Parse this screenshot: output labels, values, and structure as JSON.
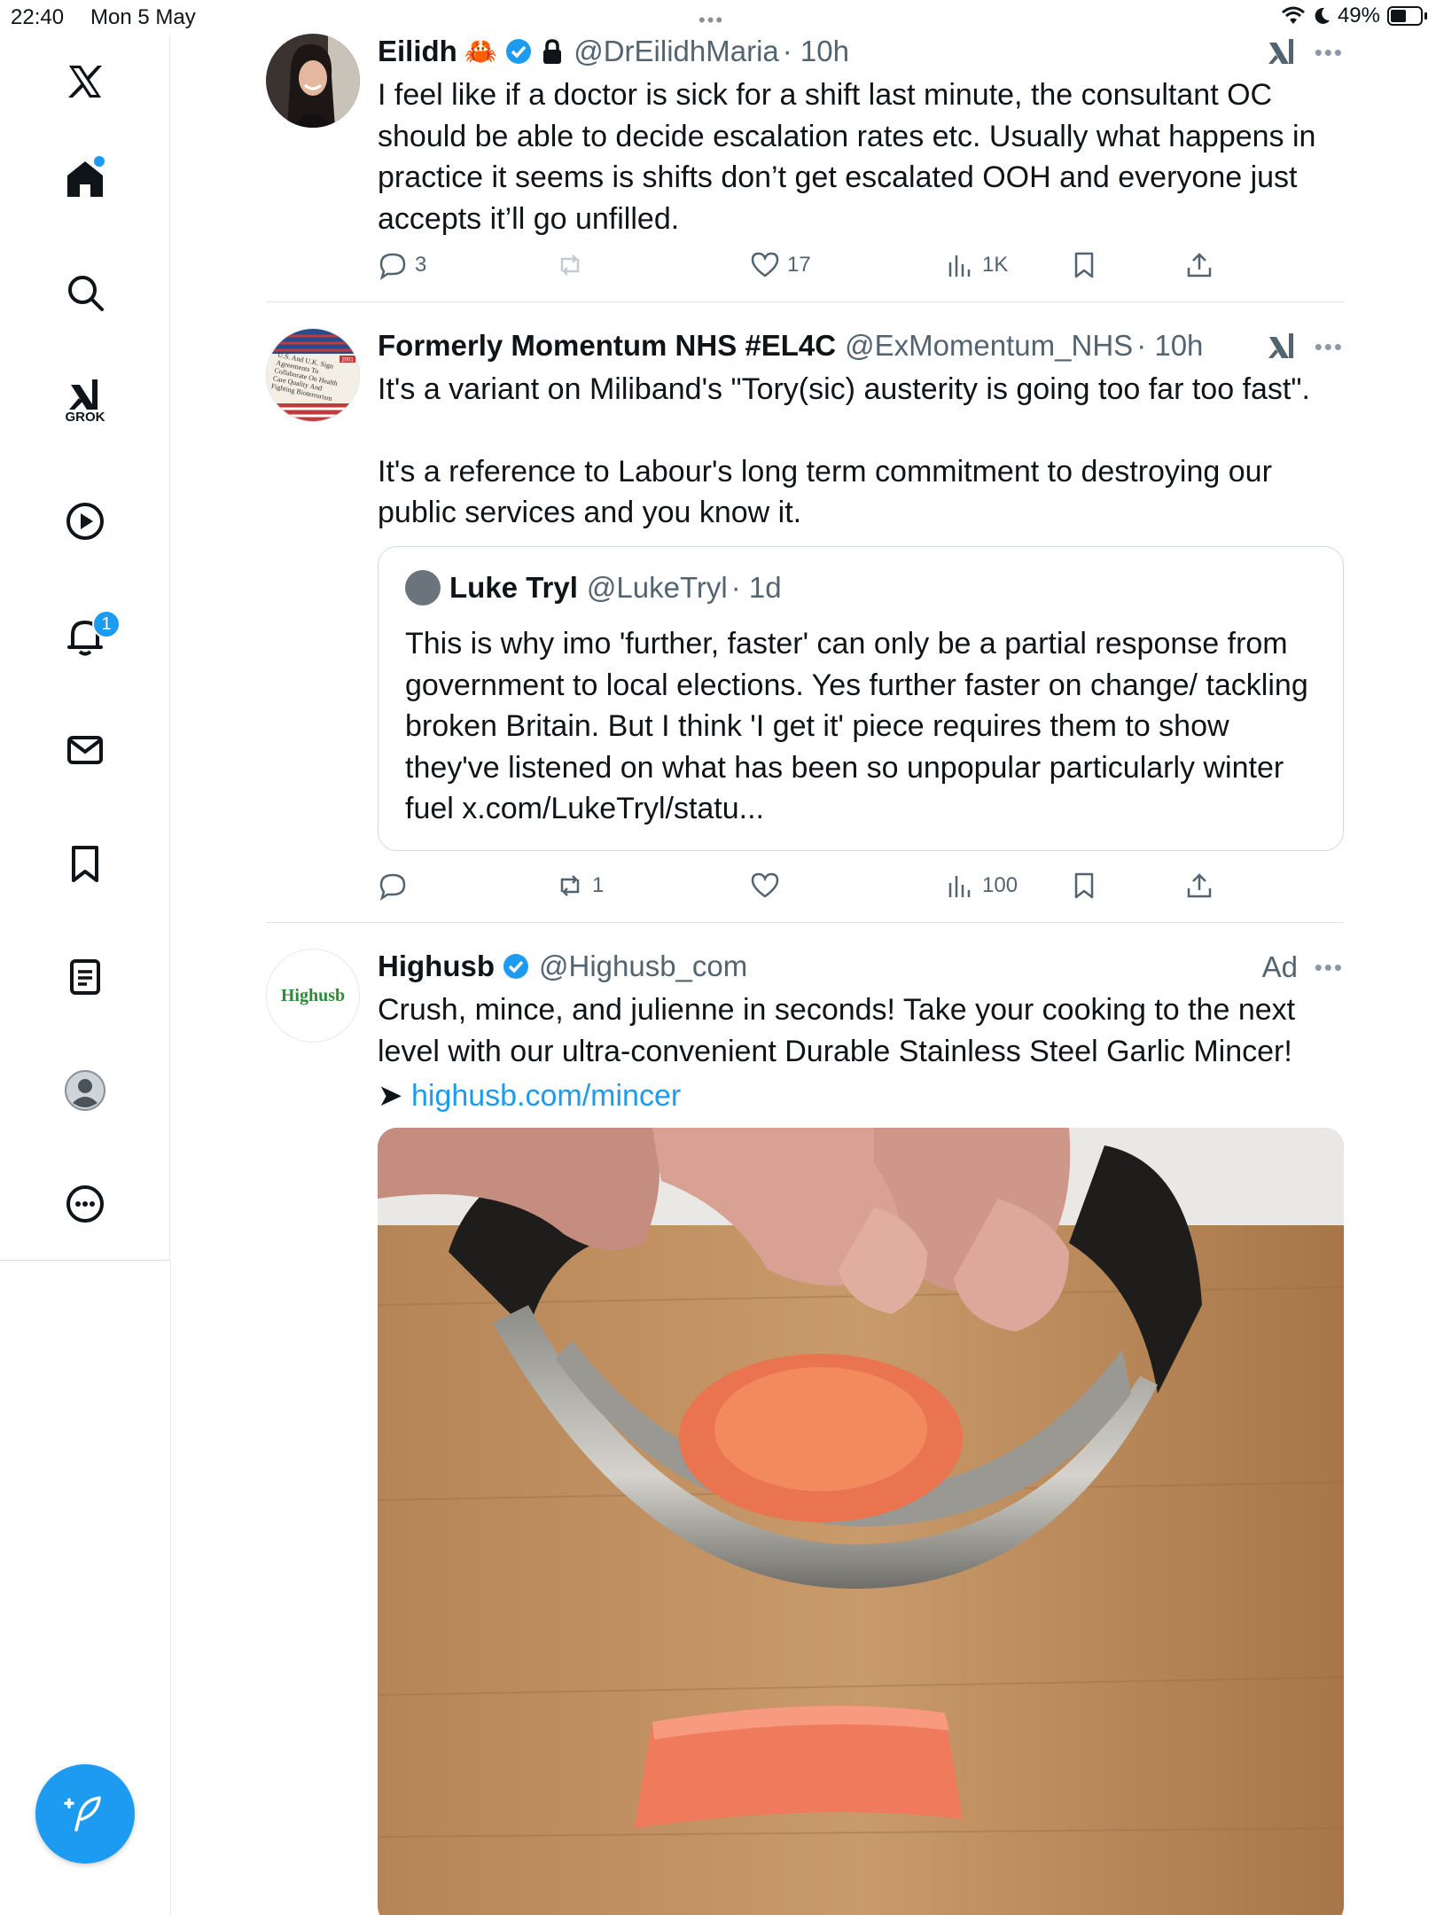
{
  "status_bar": {
    "time": "22:40",
    "date": "Mon 5 May",
    "battery": "49%"
  },
  "sidebar": {
    "items": [
      {
        "name": "x-logo-icon"
      },
      {
        "name": "home-icon"
      },
      {
        "name": "search-icon"
      },
      {
        "name": "grok-icon",
        "label": "GROK"
      },
      {
        "name": "video-icon"
      },
      {
        "name": "notifications-icon",
        "badge": "1"
      },
      {
        "name": "messages-icon"
      },
      {
        "name": "bookmarks-icon"
      },
      {
        "name": "lists-icon"
      },
      {
        "name": "profile-icon"
      },
      {
        "name": "more-icon"
      }
    ]
  },
  "tweets": [
    {
      "name": "Eilidh",
      "handle": "@DrEilidhMaria",
      "time": "· 10h",
      "text": "I feel like if a doctor is sick for a shift last minute, the consultant OC should be able to decide escalation rates etc. Usually what happens in practice it seems is shifts don’t get escalated OOH and everyone just accepts it’ll go unfilled.",
      "replies": "3",
      "retweets": "",
      "likes": "17",
      "views": "1K"
    },
    {
      "name": "Formerly Momentum NHS #EL4C",
      "handle": "@ExMomentum_NHS",
      "time": "· 10h",
      "text_p1": "It's a variant on Miliband's \"Tory(sic) austerity is going too far too fast\".",
      "text_p2": "It's a reference to Labour's long term commitment to destroying our public services and you know it.",
      "avatar_text": "U.S. And U.K. Sign Agreements To Collaborate On Health Care Quality And Fighting Bioterrorism",
      "avatar_badge": "2001",
      "quote": {
        "name": "Luke Tryl",
        "handle": "@LukeTryl",
        "time": "· 1d",
        "text": "This is why imo 'further, faster' can only be a partial response from government to local elections. Yes further faster on change/ tackling broken Britain. But I think 'I get it' piece requires them to show they've listened on what has been so unpopular particularly winter fuel x.com/LukeTryl/statu..."
      },
      "replies": "",
      "retweets": "1",
      "likes": "",
      "views": "100"
    },
    {
      "name": "Highusb",
      "handle": "@Highusb_com",
      "ad_label": "Ad",
      "avatar_text": "Highusb",
      "text": "Crush, mince, and julienne in seconds!  Take your cooking to the next level with our ultra-convenient Durable Stainless Steel Garlic Mincer!",
      "link_arrow": "➤",
      "link": "highusb.com/mincer"
    }
  ],
  "colors": {
    "accent": "#1d9bf0",
    "text": "#0f1419",
    "secondary": "#536471",
    "divider": "#dfe3e6"
  }
}
